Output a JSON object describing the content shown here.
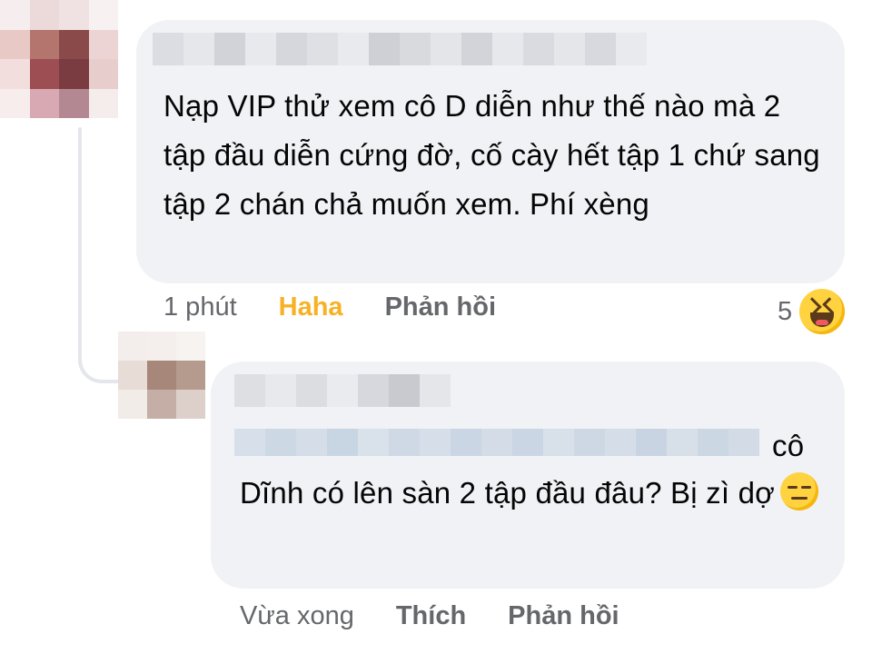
{
  "comment": {
    "text": "Nạp VIP thử xem cô D diễn như thế nào mà 2 tập đầu diễn cứng đờ, cố cày hết tập 1 chứ sang tập 2 chán chả muốn xem. Phí xèng",
    "time": "1 phút",
    "reaction_label": "Haha",
    "reply_label": "Phản hồi",
    "reaction_count": "5",
    "reaction_icon": "haha-emoji-icon"
  },
  "reply": {
    "text_first_line_end": "cô",
    "text_rest": "Dĩnh có lên sàn 2 tập đầu đâu? Bị zì dợ",
    "inline_emoji": "expressionless-face-icon",
    "time": "Vừa xong",
    "like_label": "Thích",
    "reply_label": "Phản hồi"
  },
  "colors": {
    "bubble": "#f0f2f5",
    "secondary_text": "#65676b",
    "haha": "#f7b125",
    "thread_line": "#e4e6eb"
  }
}
